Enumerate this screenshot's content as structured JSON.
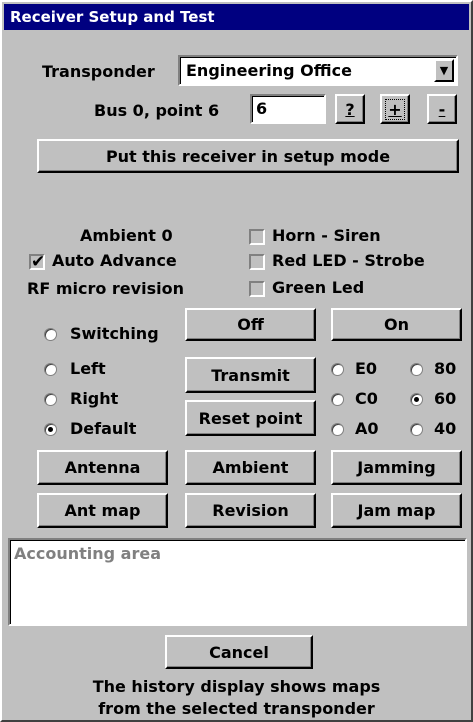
{
  "window": {
    "title": "Receiver Setup and Test"
  },
  "transponder": {
    "label": "Transponder",
    "value": "Engineering Office"
  },
  "bus_point": {
    "label": "Bus 0, point 6",
    "value": "6",
    "help_label": "?",
    "plus_label": "+",
    "minus_label": "-"
  },
  "setup_mode_button": "Put this receiver in setup mode",
  "status": {
    "ambient": "Ambient 0",
    "auto_advance_label": "Auto Advance",
    "auto_advance_checked": true,
    "rf_micro_revision": "RF micro revision"
  },
  "outputs": {
    "horn_siren": "Horn - Siren",
    "red_led_strobe": "Red LED - Strobe",
    "green_led": "Green Led"
  },
  "modes": [
    {
      "label": "Switching",
      "checked": false
    },
    {
      "label": "Left",
      "checked": false
    },
    {
      "label": "Right",
      "checked": false
    },
    {
      "label": "Default",
      "checked": true
    }
  ],
  "buttons": {
    "off": "Off",
    "on": "On",
    "transmit": "Transmit",
    "reset_point": "Reset point",
    "antenna": "Antenna",
    "ambient": "Ambient",
    "jamming": "Jamming",
    "ant_map": "Ant map",
    "revision": "Revision",
    "jam_map": "Jam map",
    "cancel": "Cancel"
  },
  "levels": [
    {
      "label": "E0",
      "checked": false
    },
    {
      "label": "80",
      "checked": false
    },
    {
      "label": "C0",
      "checked": false
    },
    {
      "label": "60",
      "checked": true
    },
    {
      "label": "A0",
      "checked": false
    },
    {
      "label": "40",
      "checked": false
    }
  ],
  "accounting_area": "Accounting area",
  "footer": {
    "line1": "The history display shows maps",
    "line2": "from the selected transponder"
  }
}
